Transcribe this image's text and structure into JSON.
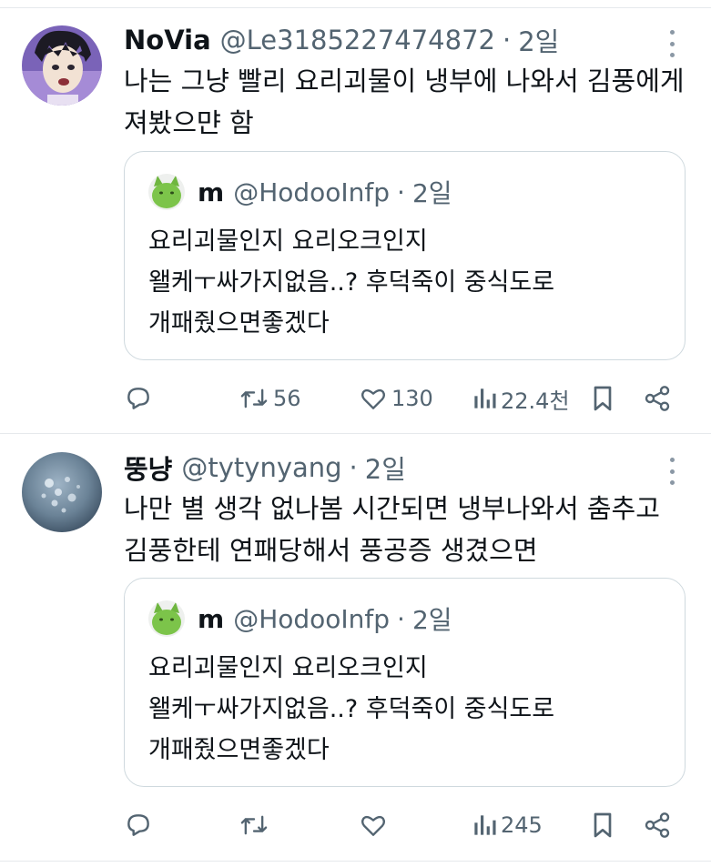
{
  "tweets": [
    {
      "name": "NoVia",
      "handle": "@Le3185227474872",
      "dot": "·",
      "time": "2일",
      "text": "나는 그냥 빨리 요리괴물이 냉부에 나와서 김풍에게\n져봤으먄 함",
      "quote": {
        "name": "m",
        "handle": "@HodooInfp",
        "dot": "·",
        "time": "2일",
        "text": "요리괴물인지 요리오크인지\n왤케ㅜ싸가지없음..?  후덕죽이 중식도로\n개패줬으면좋겠다"
      },
      "actions": {
        "replies": "",
        "retweets": "56",
        "likes": "130",
        "views": "22.4천"
      }
    },
    {
      "name": "뚱냥",
      "handle": "@tytynyang",
      "dot": "·",
      "time": "2일",
      "text": "나만 별 생각 없나봄 시간되면 냉부나와서 춤추고\n김풍한테 연패당해서 풍공증 생겼으면",
      "quote": {
        "name": "m",
        "handle": "@HodooInfp",
        "dot": "·",
        "time": "2일",
        "text": "요리괴물인지 요리오크인지\n왤케ㅜ싸가지없음..?  후덕죽이 중식도로\n개패줬으면좋겠다"
      },
      "actions": {
        "replies": "",
        "retweets": "",
        "likes": "",
        "views": "245"
      }
    }
  ],
  "icons": {
    "reply": "reply-icon",
    "retweet": "retweet-icon",
    "like": "heart-icon",
    "views": "views-chart-icon",
    "bookmark": "bookmark-icon",
    "share": "share-icon",
    "more": "more-dots-icon"
  },
  "colors": {
    "text": "#0f1419",
    "secondary": "#536471",
    "border": "#cfd9de",
    "divider": "#e6e9ec"
  }
}
